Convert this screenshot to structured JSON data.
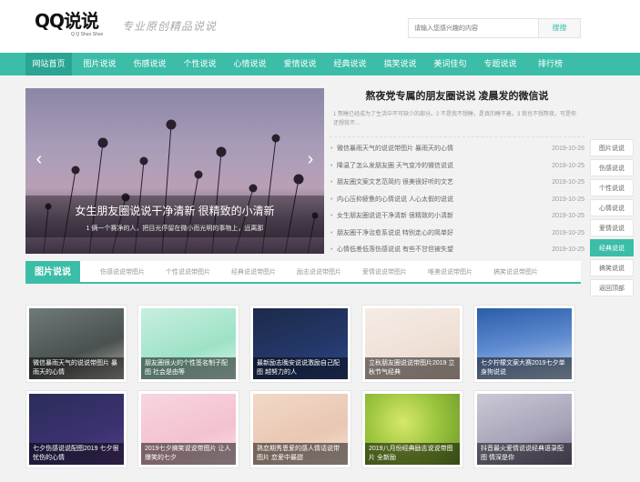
{
  "header": {
    "logo": "QQ说说",
    "logo_sub": "Q Q Shuo Shuo",
    "slogan": "专业原创精品说说",
    "search_placeholder": "请输入您感兴趣的内容",
    "search_button": "搜搜"
  },
  "nav": [
    "网站首页",
    "图片说说",
    "伤感说说",
    "个性说说",
    "心情说说",
    "爱情说说",
    "经典说说",
    "搞笑说说",
    "美词佳句",
    "专题说说",
    "排行榜"
  ],
  "slider": {
    "title": "女生朋友圈说说干净清新 很精致的小清新",
    "subtitle": "1 俩一个赛净的人，把目光停留在微小而光明的事物上，远离那",
    "prev": "‹",
    "next": "›"
  },
  "headline": {
    "title": "熬夜党专属的朋友圈说说 凌晨发的微信说",
    "desc": "1 熬睡已经成为了生活中不可缺少的部分。2 不是我不想睡，是真的睡不着。3 我也不想熬夜，可是你还想我不..."
  },
  "news": [
    {
      "title": "微信暴雨天气的说说带图片 暴雨天的心情",
      "date": "2019-10-26"
    },
    {
      "title": "降温了怎么发朋友圈 天气变冷的微信说说",
      "date": "2019-10-25"
    },
    {
      "title": "朋友圈文案文艺范简约 很美很好听的文艺",
      "date": "2019-10-25"
    },
    {
      "title": "内心压抑疲惫的心情说说 人心太假的说说",
      "date": "2019-10-25"
    },
    {
      "title": "女生朋友圈说说干净清新 很精致的小清新",
      "date": "2019-10-25"
    },
    {
      "title": "朋友圈干净治愈系说说 特别走心的简单好",
      "date": "2019-10-25"
    },
    {
      "title": "心情低差低落伤感说说 有些不甘但被失望",
      "date": "2019-10-25"
    }
  ],
  "sidenav": [
    "图片说说",
    "伤感说说",
    "个性说说",
    "心情说说",
    "爱情说说",
    "经典说说",
    "搞笑说说",
    "返回顶部"
  ],
  "section": {
    "title": "图片说说",
    "tabs": [
      "伤感说说带图片",
      "个性说说带图片",
      "经典说说带图片",
      "励志说说带图片",
      "爱情说说带图片",
      "唯美说说带图片",
      "搞笑说说带图片"
    ]
  },
  "gallery": [
    {
      "caption": "微信暴雨天气的说说带图片 暴雨天的心情"
    },
    {
      "caption": "朋友圈很火的个性签名制子配图 社会是由等"
    },
    {
      "caption": "最新励志晚安说说激励自己配图 越努力的人"
    },
    {
      "caption": "立秋朋友圈说说带图片2019 立秋节气经典"
    },
    {
      "caption": "七夕柠檬文案大赛2019七夕单身狗说说"
    },
    {
      "caption": "七夕伤感说说配图2019 七夕很忧伤的心情"
    },
    {
      "caption": "2019七夕搞笑说说带图片 让人爆笑的七夕"
    },
    {
      "caption": "熟恋期秀恩爱的感人情话说带图片 恋爱中最甜"
    },
    {
      "caption": "2019八月份经典励志说说带图片 全新励"
    },
    {
      "caption": "抖音最火爱情说说经典语录配图 情深是你"
    }
  ],
  "colors": {
    "accent": "#3cbda8",
    "accent_dark": "#2aa593"
  }
}
